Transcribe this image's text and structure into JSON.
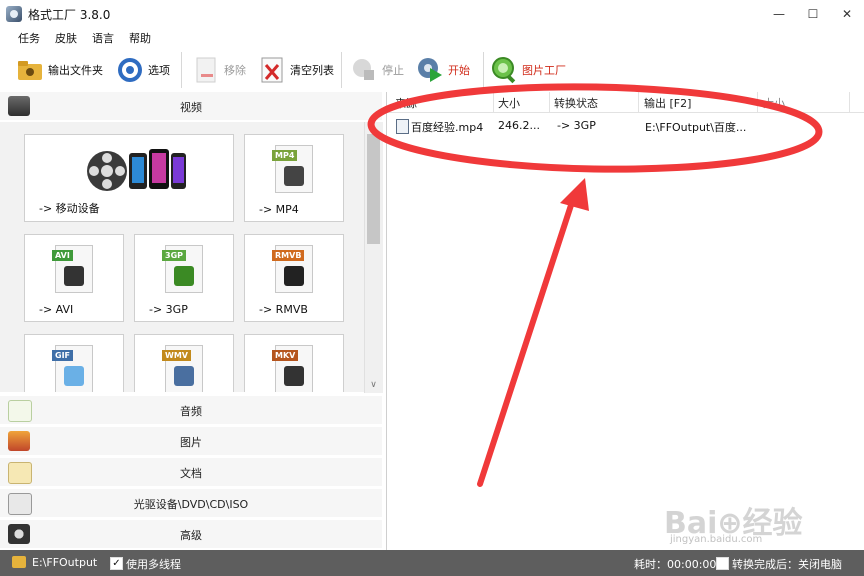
{
  "window": {
    "title": "格式工厂 3.8.0",
    "controls": [
      "—",
      "☐",
      "✕"
    ]
  },
  "menu": [
    "任务",
    "皮肤",
    "语言",
    "帮助"
  ],
  "toolbar": {
    "output_folder": "输出文件夹",
    "options": "选项",
    "remove": "移除",
    "clear_list": "清空列表",
    "stop": "停止",
    "start": "开始",
    "picture_factory": "图片工厂"
  },
  "left": {
    "video_label": "视频",
    "tiles": [
      {
        "label": "-> 移动设备",
        "tag": ""
      },
      {
        "label": "-> MP4",
        "tag": "MP4"
      },
      {
        "label": "-> AVI",
        "tag": "AVI"
      },
      {
        "label": "-> 3GP",
        "tag": "3GP"
      },
      {
        "label": "-> RMVB",
        "tag": "RMVB"
      },
      {
        "label": "",
        "tag": "GIF"
      },
      {
        "label": "",
        "tag": "WMV"
      },
      {
        "label": "",
        "tag": "MKV"
      }
    ],
    "categories": {
      "audio": "音频",
      "picture": "图片",
      "document": "文档",
      "disc": "光驱设备\\DVD\\CD\\ISO",
      "advanced": "高级"
    }
  },
  "list": {
    "headers": [
      "来源",
      "大小",
      "转换状态",
      "输出 [F2]",
      "大小"
    ],
    "rows": [
      {
        "source": "百度经验.mp4",
        "size": "246.2...",
        "status": "-> 3GP",
        "output": "E:\\FFOutput\\百度...",
        "out_size": ""
      }
    ]
  },
  "watermark": {
    "main": "Bai⊕经验",
    "sub": "jingyan.baidu.com"
  },
  "status": {
    "output_path": "E:\\FFOutput",
    "multithread_label": "使用多线程",
    "multithread_checked": "✓",
    "elapsed": "耗时：00:00:00",
    "after_convert": "转换完成后：关闭电脑"
  },
  "colors": {
    "annotation": "#f0393a",
    "statusbar": "#5e5e5e"
  }
}
